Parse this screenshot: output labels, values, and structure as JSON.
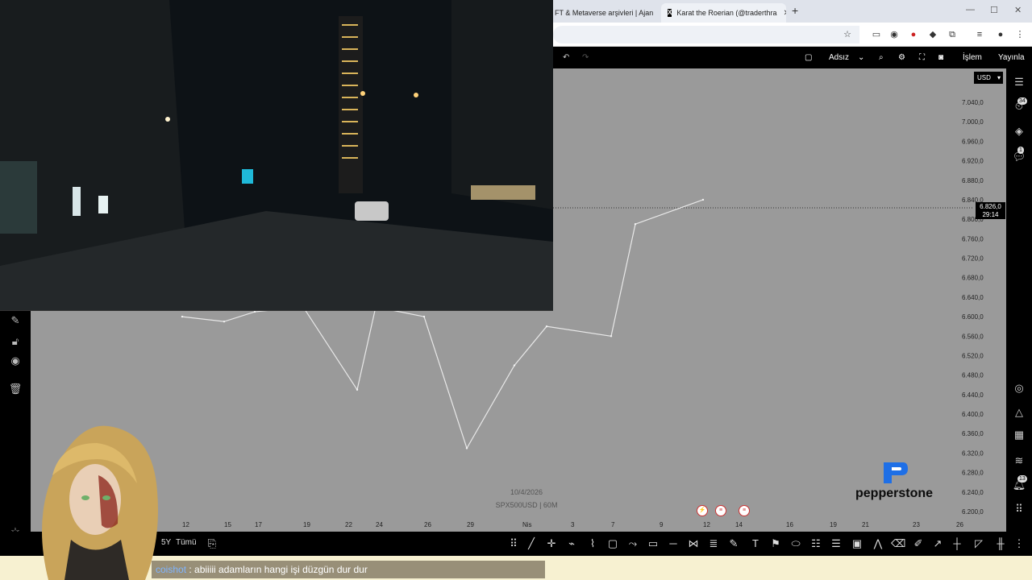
{
  "browser": {
    "tabs": [
      {
        "label": "FT & Metaverse arşivleri | Ajan"
      },
      {
        "label": "Karat the Roerian (@traderthra"
      }
    ],
    "new_tab": "+"
  },
  "tv_header": {
    "layout_name": "Adsız",
    "trade_label": "İşlem",
    "publish_label": "Yayınla"
  },
  "chart": {
    "currency": "USD",
    "current_price": "6.826,0",
    "countdown": "29:14",
    "watermark_date": "10/4/2026",
    "watermark_symbol": "SPX500USD | 60M",
    "price_ticks": [
      "7.040,0",
      "7.000,0",
      "6.960,0",
      "6.920,0",
      "6.880,0",
      "6.840,0",
      "6.800,0",
      "6.760,0",
      "6.720,0",
      "6.680,0",
      "6.640,0",
      "6.600,0",
      "6.560,0",
      "6.520,0",
      "6.480,0",
      "6.440,0",
      "6.400,0",
      "6.360,0",
      "6.320,0",
      "6.280,0",
      "6.240,0",
      "6.200,0"
    ],
    "time_ticks": [
      "12",
      "15",
      "17",
      "19",
      "22",
      "24",
      "26",
      "29",
      "Nis",
      "3",
      "7",
      "9",
      "12",
      "14",
      "16",
      "19",
      "21",
      "23",
      "26"
    ]
  },
  "chart_data": {
    "type": "line",
    "title": "",
    "xlabel": "",
    "ylabel": "",
    "x": [
      "12",
      "15",
      "17",
      "19",
      "22",
      "24",
      "26",
      "29",
      "Nis",
      "3",
      "7",
      "9",
      "12"
    ],
    "series": [
      {
        "values": [
          6600,
          6590,
          6610,
          6620,
          6450,
          6620,
          6600,
          6330,
          6500,
          6580,
          6560,
          6790,
          6840
        ]
      }
    ],
    "ylim": [
      6200,
      7040
    ],
    "grid": false
  },
  "right_badges": {
    "alerts": "34",
    "chat": "1",
    "notifications": "13"
  },
  "bottom_toolbar": {
    "range_y": "Y",
    "range_5y": "5Y",
    "range_all": "Tümü"
  },
  "broker": {
    "name": "pepperstone"
  },
  "chat": {
    "username": "coishot",
    "separator": " : ",
    "message": "abiiiii adamların hangi işi düzgün dur dur"
  },
  "colors": {
    "chart_bg": "#9a9a9a",
    "toolbar_bg": "#000000",
    "chat_bg": "#f7f1d1",
    "username": "#7fb4ff"
  }
}
